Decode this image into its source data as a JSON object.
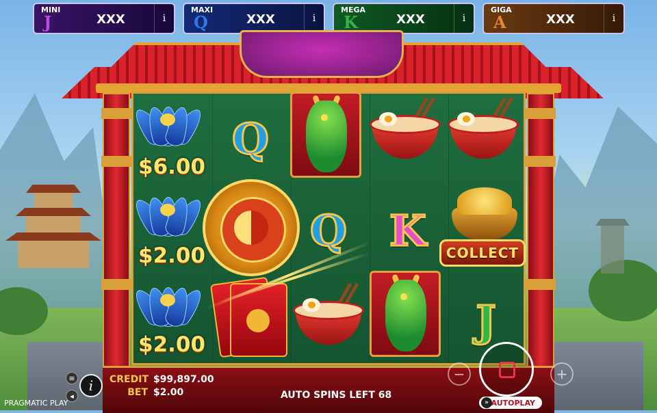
{
  "jackpots": [
    {
      "name": "MINI",
      "letter": "J",
      "value": "XXX",
      "info": "i",
      "color": "#b64fe0"
    },
    {
      "name": "MAXI",
      "letter": "Q",
      "value": "XXX",
      "info": "i",
      "color": "#2f79e6"
    },
    {
      "name": "MEGA",
      "letter": "K",
      "value": "XXX",
      "info": "i",
      "color": "#33b248"
    },
    {
      "name": "GIGA",
      "letter": "A",
      "value": "XXX",
      "info": "i",
      "color": "#e0882d"
    }
  ],
  "reels": {
    "lotus_values": [
      "$6.00",
      "$2.00",
      "$2.00"
    ],
    "symbols": {
      "q1": "Q",
      "q2": "Q",
      "k": "K",
      "j": "J"
    },
    "collect_label": "COLLECT"
  },
  "footer": {
    "credit_label": "CREDIT",
    "credit_value": "$99,897.00",
    "bet_label": "BET",
    "bet_value": "$2.00",
    "auto_spins": "AUTO SPINS LEFT 68",
    "autoplay_label": "AUTOPLAY",
    "brand": "PRAGMATIC PLAY",
    "info_glyph": "i",
    "minus_glyph": "−",
    "plus_glyph": "+"
  },
  "colors": {
    "accent_gold": "#d9a03a",
    "temple_red": "#d9232c",
    "reel_green": "#1f6e3f",
    "stop_red": "#e8344a"
  }
}
